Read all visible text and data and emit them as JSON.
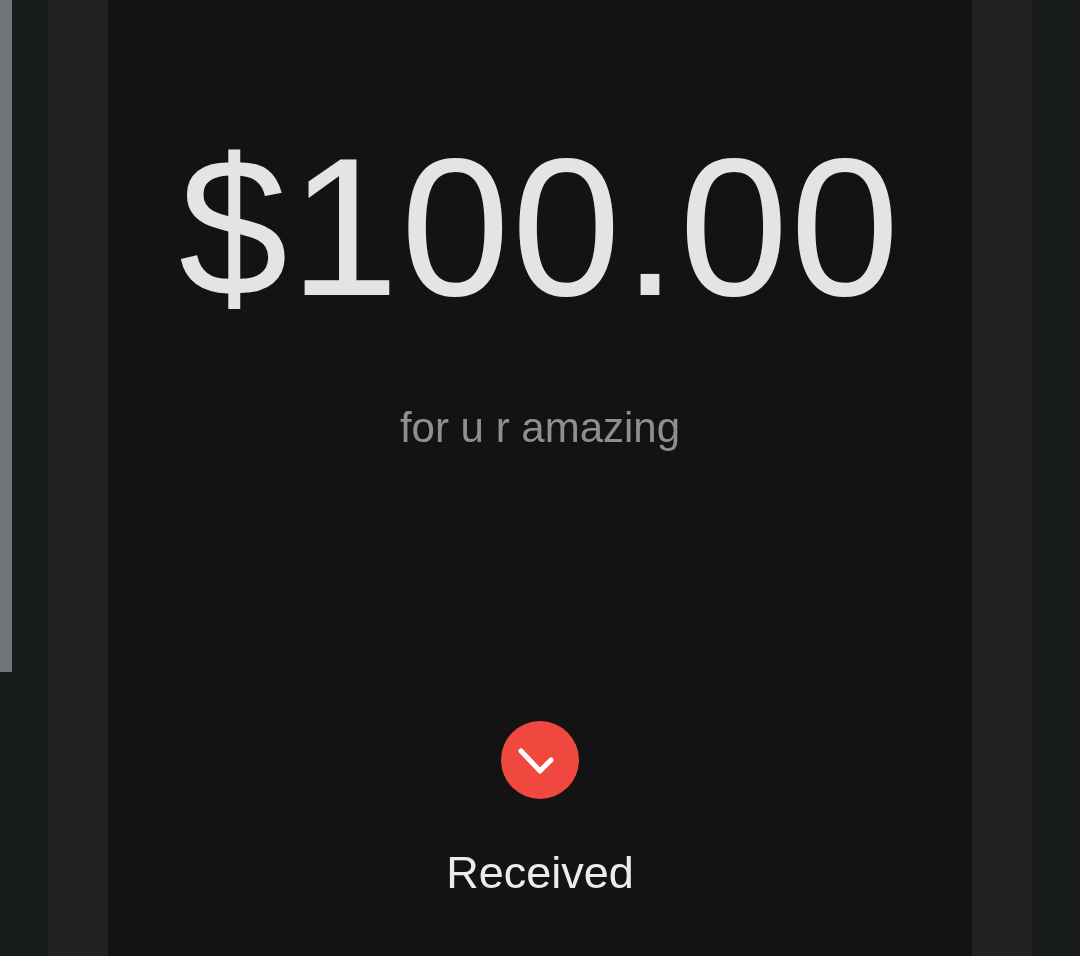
{
  "payment": {
    "amount": "$100.00",
    "note": "for u r amazing",
    "status": "Received"
  }
}
